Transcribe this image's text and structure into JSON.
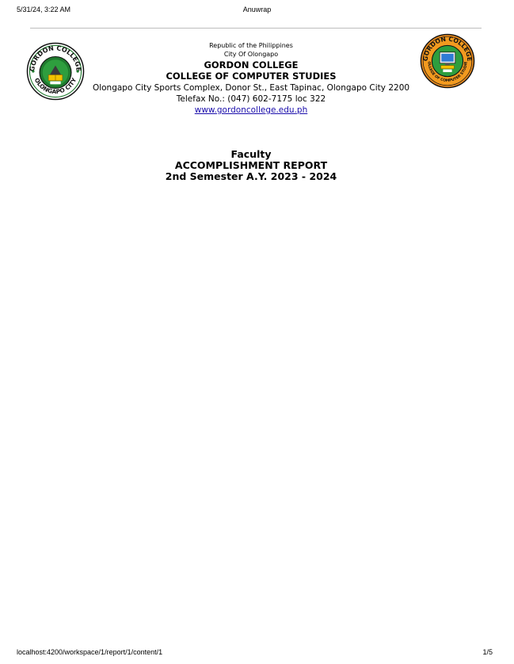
{
  "print_header": {
    "datetime": "5/31/24, 3:22 AM",
    "title": "Anuwrap"
  },
  "letterhead": {
    "republic": "Republic of the Philippines",
    "city": "City Of Olongapo",
    "school": "GORDON COLLEGE",
    "department": "COLLEGE OF COMPUTER STUDIES",
    "address": "Olongapo City Sports Complex, Donor St., East Tapinac, Olongapo City 2200",
    "telefax": "Telefax No.: (047) 602-7175 loc 322",
    "website": "www.gordoncollege.edu.ph"
  },
  "seals": {
    "left": {
      "top_text": "GORDON COLLEGE",
      "bottom_text": "OLONGAPO CITY",
      "year": "1999",
      "colors": {
        "ring": "#1f7a2e",
        "inner": "#2e9e3e",
        "accent": "#f2c200"
      }
    },
    "right": {
      "top_text": "GORDON COLLEGE",
      "bottom_text": "COLLEGE OF COMPUTER STUDIES",
      "year": "1999",
      "colors": {
        "ring": "#e8891c",
        "inner": "#f29a1f",
        "accent": "#2e9e3e"
      }
    }
  },
  "report": {
    "line1": "Faculty",
    "line2": "ACCOMPLISHMENT REPORT",
    "line3": "2nd Semester A.Y. 2023 - 2024"
  },
  "print_footer": {
    "url": "localhost:4200/workspace/1/report/1/content/1",
    "page": "1/5"
  }
}
